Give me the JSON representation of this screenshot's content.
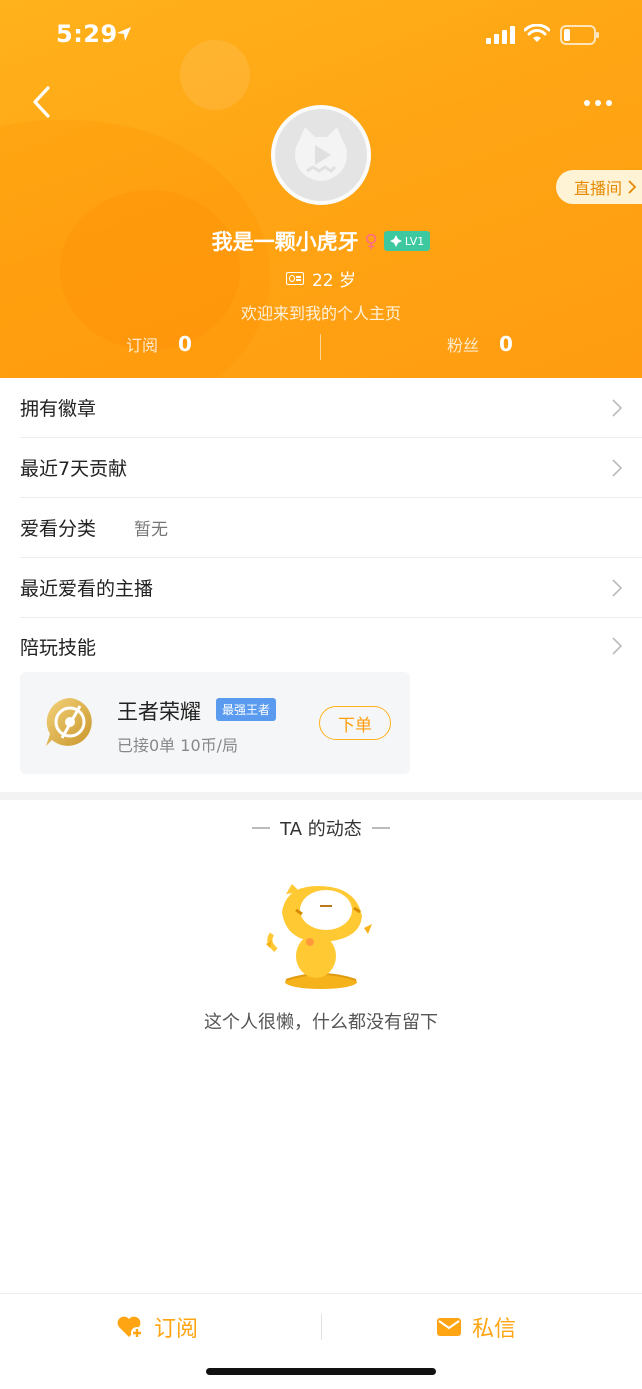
{
  "status_bar": {
    "time": "5:29"
  },
  "header": {
    "live_room_label": "直播间",
    "username": "我是一颗小虎牙",
    "gender_symbol": "♀",
    "level": "LV1",
    "age": "22 岁",
    "signature": "欢迎来到我的个人主页",
    "stats": [
      {
        "label": "订阅",
        "value": "0"
      },
      {
        "label": "粉丝",
        "value": "0"
      }
    ]
  },
  "rows": {
    "badges": "拥有徽章",
    "contribution": "最近7天贡献",
    "favorite_category": "爱看分类",
    "favorite_category_value": "暂无",
    "recent_streamers": "最近爱看的主播",
    "play_skills": "陪玩技能"
  },
  "skill_card": {
    "game_name": "王者荣耀",
    "rank": "最强王者",
    "stats": "已接0单 10币/局",
    "order_button": "下单"
  },
  "feed": {
    "title": "TA 的动态",
    "empty_text": "这个人很懒，什么都没有留下"
  },
  "bottom_bar": {
    "subscribe": "订阅",
    "message": "私信"
  },
  "colors": {
    "brand_orange": "#ffa514",
    "level_badge": "#3ec8a0",
    "rank_badge": "#5a9bf0"
  },
  "icons": [
    "back-arrow-icon",
    "more-dots-icon",
    "chevron-right-icon",
    "female-icon",
    "diamond-icon",
    "id-card-icon",
    "heart-plus-icon",
    "mail-icon",
    "game-icon"
  ]
}
